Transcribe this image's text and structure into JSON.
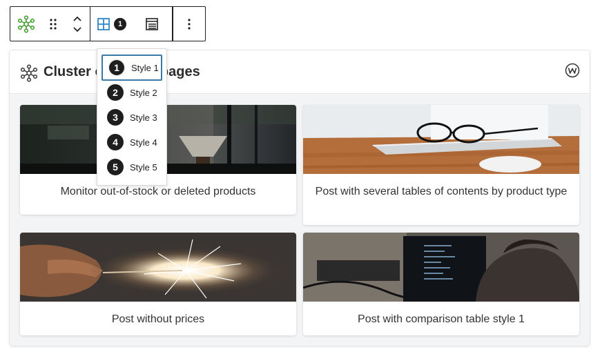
{
  "toolbar": {
    "block_icon": "cluster-network-icon",
    "drag_icon": "drag-handle-icon",
    "move_icon": "chevron-up-down-icon",
    "layout_icon": "grid-layout-icon",
    "style_badge": "1",
    "list_icon": "list-view-icon",
    "more_icon": "more-options-icon"
  },
  "block": {
    "title": "Cluster of similar pages",
    "title_icon": "cluster-network-icon",
    "brand_icon": "brand-w-icon"
  },
  "dropdown": {
    "selected": 1,
    "options": [
      {
        "num": "1",
        "label": "Style 1"
      },
      {
        "num": "2",
        "label": "Style 2"
      },
      {
        "num": "3",
        "label": "Style 3"
      },
      {
        "num": "4",
        "label": "Style 4"
      },
      {
        "num": "5",
        "label": "Style 5"
      }
    ]
  },
  "cards": [
    {
      "caption": "Monitor out-of-stock or deleted products",
      "image": "coffee-bar-photo"
    },
    {
      "caption": "Post with several tables of contents by product type",
      "image": "glasses-laptop-photo"
    },
    {
      "caption": "Post without prices",
      "image": "sparkler-photo"
    },
    {
      "caption": "Post with comparison table style 1",
      "image": "computer-screen-photo"
    }
  ],
  "colors": {
    "accent_green": "#3a9a25",
    "accent_blue": "#2f86c8",
    "focus_blue": "#3a78a8",
    "body_bg": "#f3f4f5"
  }
}
